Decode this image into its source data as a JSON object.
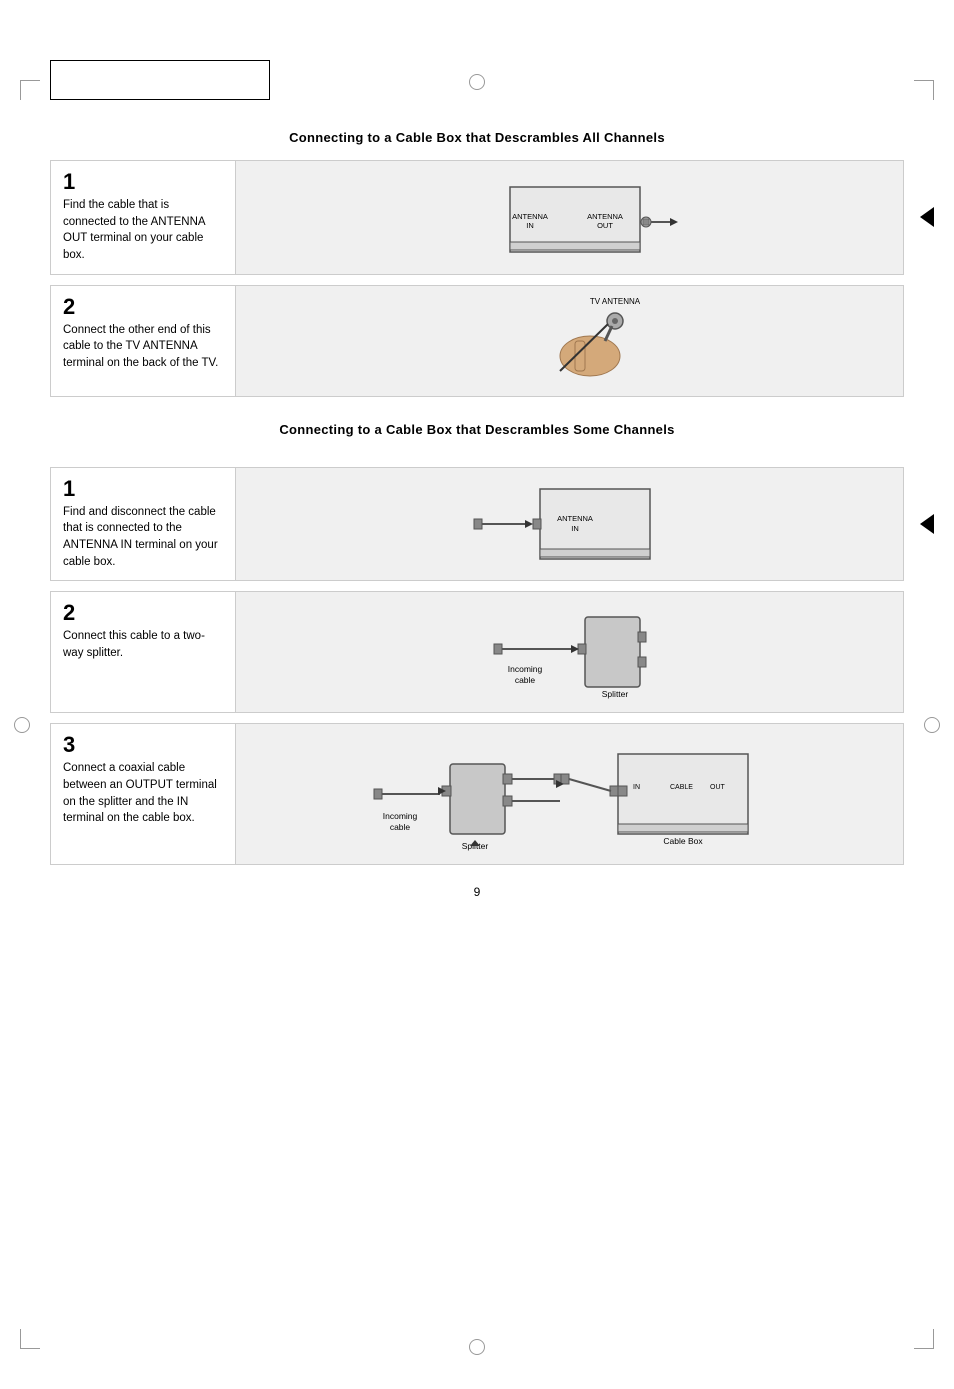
{
  "page": {
    "number": "9"
  },
  "section1": {
    "title": "Connecting to a Cable Box that Descrambles All Channels",
    "steps": [
      {
        "number": "1",
        "text": "Find the cable that is connected to the ANTENNA OUT terminal on your cable box.",
        "diagram": "cable-box-antenna-out"
      },
      {
        "number": "2",
        "text": "Connect the other end of this cable to the TV ANTENNA terminal on the back of the TV.",
        "diagram": "tv-antenna-connect"
      }
    ]
  },
  "section2": {
    "title": "Connecting to a Cable Box that Descrambles Some Channels",
    "steps": [
      {
        "number": "1",
        "text": "Find and disconnect the cable that is connected to the ANTENNA IN terminal on your cable box.",
        "diagram": "cable-box-antenna-in"
      },
      {
        "number": "2",
        "text": "Connect this cable to a two-way splitter.",
        "diagram": "splitter-connect",
        "label_incoming": "Incoming cable",
        "label_splitter": "Splitter"
      },
      {
        "number": "3",
        "text": "Connect a coaxial cable between an OUTPUT terminal on the splitter and the IN terminal on the cable box.",
        "diagram": "splitter-to-cable-box",
        "label_incoming": "Incoming cable",
        "label_splitter": "Splitter",
        "label_cablebox": "Cable  Box"
      }
    ]
  }
}
